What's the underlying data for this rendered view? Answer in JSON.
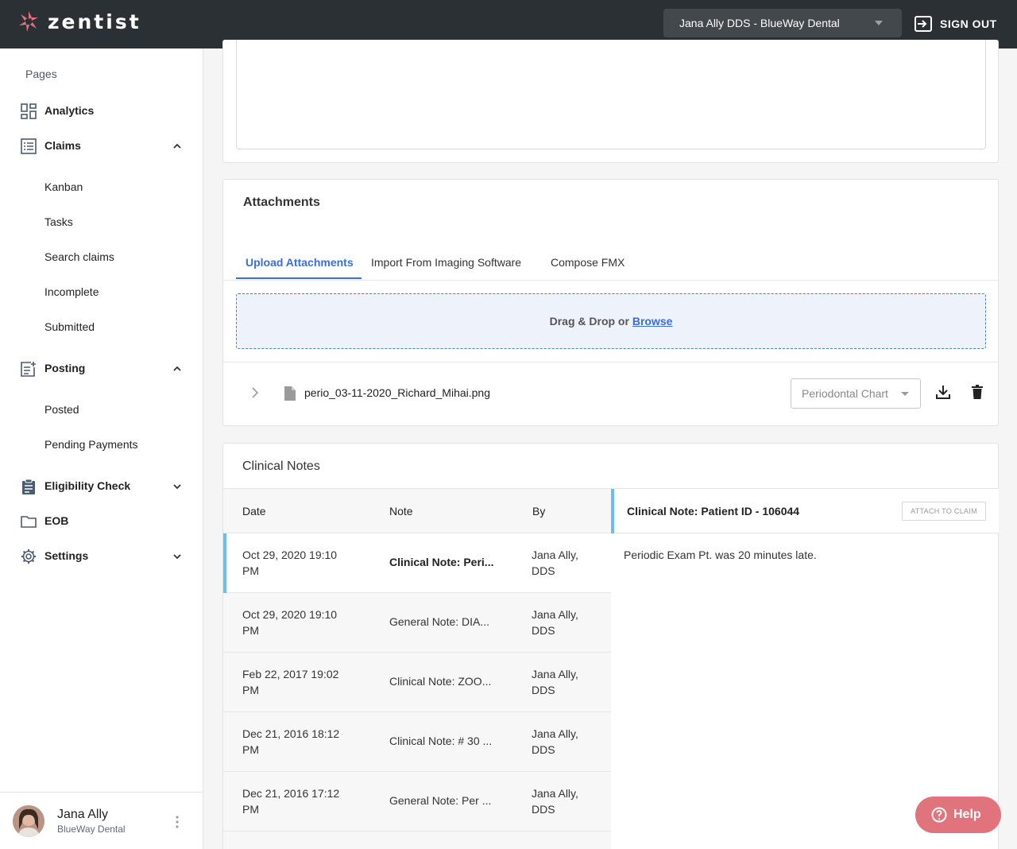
{
  "header": {
    "logo_text": "zentist",
    "practice_select": "Jana Ally DDS - BlueWay Dental",
    "signout_label": "SIGN OUT"
  },
  "sidebar": {
    "pages_label": "Pages",
    "items": [
      {
        "label": "Analytics",
        "icon": "analytics-icon"
      },
      {
        "label": "Claims",
        "icon": "claims-icon",
        "expanded": true,
        "children": [
          "Kanban",
          "Tasks",
          "Search claims",
          "Incomplete",
          "Submitted"
        ]
      },
      {
        "label": "Posting",
        "icon": "posting-icon",
        "expanded": true,
        "children": [
          "Posted",
          "Pending Payments"
        ]
      },
      {
        "label": "Eligibility Check",
        "icon": "clipboard-icon",
        "expanded": false
      },
      {
        "label": "EOB",
        "icon": "folder-icon"
      },
      {
        "label": "Settings",
        "icon": "gear-icon",
        "expanded": false
      }
    ],
    "user": {
      "name": "Jana Ally",
      "org": "BlueWay Dental"
    }
  },
  "attachments": {
    "title": "Attachments",
    "tabs": [
      "Upload Attachments",
      "Import From Imaging Software",
      "Compose FMX"
    ],
    "active_tab": "Upload Attachments",
    "dropzone_text": "Drag & Drop or",
    "browse_label": "Browse",
    "file": {
      "name": "perio_03-11-2020_Richard_Mihai.png",
      "type_placeholder": "Periodontal Chart"
    }
  },
  "clinical_notes": {
    "title": "Clinical Notes",
    "columns": [
      "Date",
      "Note",
      "By"
    ],
    "rows": [
      {
        "date": "Oct 29, 2020 19:10 PM",
        "note": "Clinical Note: Peri...",
        "by": "Jana Ally, DDS",
        "selected": true
      },
      {
        "date": "Oct 29, 2020 19:10 PM",
        "note": "General Note: DIA...",
        "by": "Jana Ally, DDS"
      },
      {
        "date": "Feb 22, 2017 19:02 PM",
        "note": "Clinical Note: ZOO...",
        "by": "Jana Ally, DDS"
      },
      {
        "date": "Dec 21, 2016 18:12 PM",
        "note": "Clinical Note: # 30 ...",
        "by": "Jana Ally, DDS"
      },
      {
        "date": "Dec 21, 2016 17:12 PM",
        "note": "General Note: Per ...",
        "by": "Jana Ally, DDS"
      }
    ],
    "detail": {
      "title": "Clinical Note: Patient ID - 106044",
      "attach_label": "ATTACH TO CLAIM",
      "body": "Periodic Exam Pt. was 20 minutes late."
    }
  },
  "help_label": "Help",
  "colors": {
    "accent": "#3b6ed6",
    "topbar": "#2b3035",
    "help": "#e0737c",
    "selection": "#6cc0e8",
    "logo": "#e0737c"
  }
}
